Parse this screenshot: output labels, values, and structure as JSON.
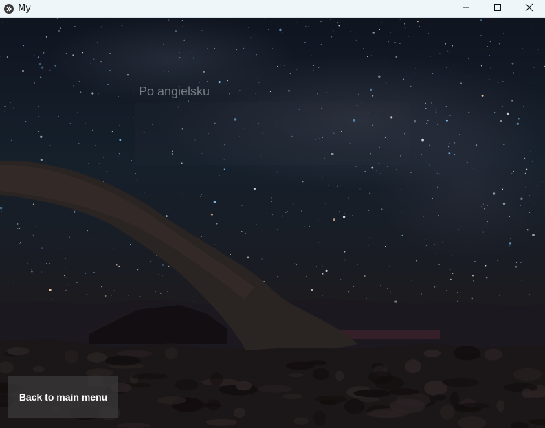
{
  "window": {
    "title": "My",
    "controls": [
      "minimize-icon",
      "maximize-icon",
      "close-icon"
    ]
  },
  "main": {
    "label": "Po angielsku",
    "back_button_label": "Back to main menu"
  },
  "colors": {
    "titlebar_bg": "#eef6f9",
    "label_text": "#777b82",
    "button_bg": "#3c3a3c",
    "button_text": "#ffffff"
  }
}
